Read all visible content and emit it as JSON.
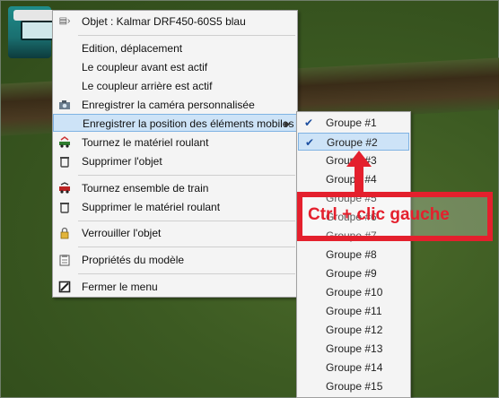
{
  "context_menu": {
    "items": [
      {
        "label": "Objet : Kalmar DRF450-60S5 blau",
        "icon": "object-arrow-icon"
      },
      {
        "label": "Edition, déplacement",
        "icon": ""
      },
      {
        "label": "Le coupleur avant est actif",
        "icon": ""
      },
      {
        "label": "Le coupleur arrière est actif",
        "icon": ""
      },
      {
        "label": "Enregistrer la caméra personnalisée",
        "icon": "camera-icon"
      },
      {
        "label": "Enregistrer la position des éléments mobiles",
        "icon": "",
        "highlighted": true,
        "has_submenu": true
      },
      {
        "label": "Tournez le matériel roulant",
        "icon": "rotate-vehicle-icon"
      },
      {
        "label": "Supprimer l'objet",
        "icon": "trash-icon"
      },
      {
        "label": "Tournez ensemble de train",
        "icon": "rotate-train-icon"
      },
      {
        "label": "Supprimer le matériel roulant",
        "icon": "trash-icon"
      },
      {
        "label": "Verrouiller l'objet",
        "icon": "lock-icon"
      },
      {
        "label": "Propriétés du modèle",
        "icon": "properties-icon"
      },
      {
        "label": "Fermer le menu",
        "icon": "close-menu-icon"
      }
    ]
  },
  "submenu": {
    "items": [
      {
        "label": "Groupe #1",
        "checked": true
      },
      {
        "label": "Groupe #2",
        "checked": true,
        "highlighted": true
      },
      {
        "label": "Groupe #3"
      },
      {
        "label": "Groupe #4"
      },
      {
        "label": "Groupe #5"
      },
      {
        "label": "Groupe #6"
      },
      {
        "label": "Groupe #7"
      },
      {
        "label": "Groupe #8"
      },
      {
        "label": "Groupe #9"
      },
      {
        "label": "Groupe #10"
      },
      {
        "label": "Groupe #11"
      },
      {
        "label": "Groupe #12"
      },
      {
        "label": "Groupe #13"
      },
      {
        "label": "Groupe #14"
      },
      {
        "label": "Groupe #15"
      }
    ]
  },
  "annotation": {
    "text": "Ctrl + clic gauche",
    "color": "#e4202d"
  },
  "colors": {
    "highlight": "#cde3f7",
    "check": "#1d4fa0"
  }
}
